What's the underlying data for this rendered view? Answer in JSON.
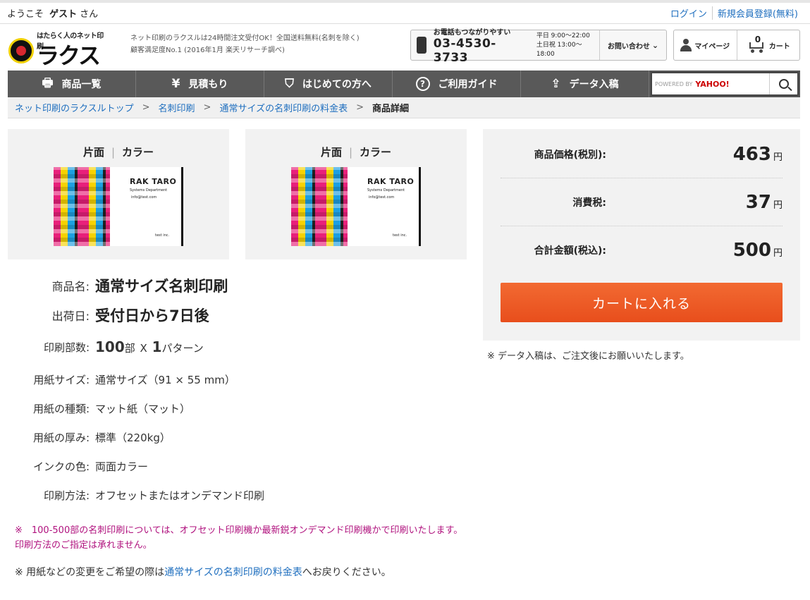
{
  "topbar": {
    "welcome_prefix": "ようこそ",
    "user_name": "ゲスト",
    "welcome_suffix": "さん",
    "login": "ログイン",
    "register": "新規会員登録(無料)"
  },
  "header": {
    "logo_tag": "はたらく人のネット印刷",
    "logo_wordmark": "ラクスル",
    "tagline_1": "ネット印刷のラクスルは24時間注文受付OK！全国送料無料(名刺を除く)",
    "tagline_2": "顧客満足度No.1 (2016年1月 楽天リサーチ調べ)",
    "phone_caption": "お電話もつながりやすい",
    "phone_number": "03-4530-3733",
    "hours_1": "平日 9:00～22:00",
    "hours_2": "土日祝 13:00～18:00",
    "inquiry": "お問い合わせ",
    "mypage": "マイページ",
    "cart": "カート",
    "cart_count": "0"
  },
  "nav": {
    "items": [
      {
        "label": "商品一覧",
        "icon": "printer-icon"
      },
      {
        "label": "見積もり",
        "icon": "yen-icon"
      },
      {
        "label": "はじめての方へ",
        "icon": "shield-icon"
      },
      {
        "label": "ご利用ガイド",
        "icon": "help-icon"
      },
      {
        "label": "データ入稿",
        "icon": "upload-icon"
      }
    ],
    "search_powered": "POWERED BY",
    "search_brand": "YAHOO!"
  },
  "breadcrumb": {
    "items": [
      "ネット印刷のラクスルトップ",
      "名刺印刷",
      "通常サイズの名刺印刷の料金表"
    ],
    "current": "商品詳細",
    "separator": ">"
  },
  "previews": [
    {
      "side": "片面",
      "color": "カラー"
    },
    {
      "side": "片面",
      "color": "カラー"
    }
  ],
  "bizcard": {
    "name": "RAK TARO",
    "dept": "Systems Department",
    "email": "info@test.com",
    "company": "test inc."
  },
  "spec": {
    "product_label": "商品名:",
    "product_value": "通常サイズ名刺印刷",
    "ship_label": "出荷日:",
    "ship_value": "受付日から7日後",
    "qty_label": "印刷部数:",
    "qty_num": "100",
    "qty_unit": "部",
    "qty_x": "X",
    "qty_patterns": "1",
    "qty_pattern_unit": "パターン",
    "size_label": "用紙サイズ:",
    "size_value": "通常サイズ（91 × 55 mm）",
    "type_label": "用紙の種類:",
    "type_value": "マット紙（マット）",
    "thick_label": "用紙の厚み:",
    "thick_value": "標準（220kg）",
    "ink_label": "インクの色:",
    "ink_value": "両面カラー",
    "method_label": "印刷方法:",
    "method_value": "オフセットまたはオンデマンド印刷"
  },
  "notes": {
    "note1": "※　100-500部の名刺印刷については、オフセット印刷機か最新鋭オンデマンド印刷機かで印刷いたします。印刷方法のご指定は承れません。",
    "note2_prefix": "※ 用紙などの変更をご希望の際は",
    "note2_link": "通常サイズの名刺印刷の料金表",
    "note2_suffix": "へお戻りください。"
  },
  "price": {
    "base_label": "商品価格(税別):",
    "base_value": "463",
    "tax_label": "消費税:",
    "tax_value": "37",
    "total_label": "合計金額(税込):",
    "total_value": "500",
    "currency": "円",
    "cart_button": "カートに入れる",
    "note": "※ データ入稿は、ご注文後にお願いいたします。"
  },
  "colors": {
    "accent_orange": "#ec5a22",
    "link_blue": "#1f6fbf",
    "nav_gray": "#595959",
    "note_magenta": "#b0127e"
  }
}
